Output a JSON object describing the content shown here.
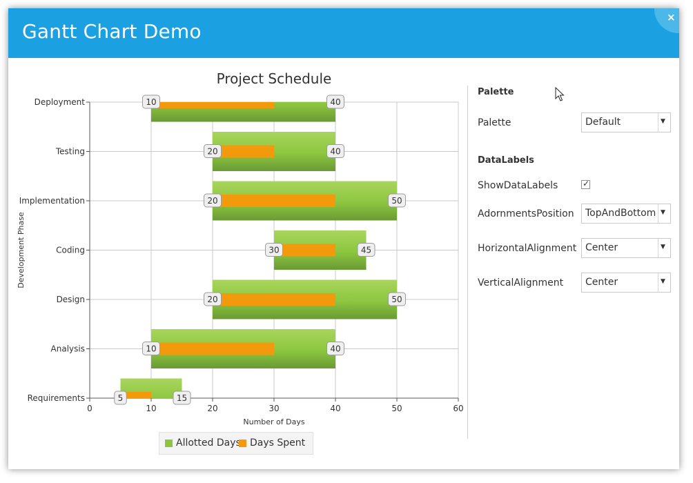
{
  "window": {
    "title": "Gantt Chart Demo",
    "close_glyph": "×"
  },
  "colors": {
    "titlebar": "#1ba1e2",
    "allotted": "#8cc63f",
    "spent": "#f39a0c"
  },
  "chart_data": {
    "type": "bar",
    "orientation": "horizontal-range",
    "title": "Project Schedule",
    "xlabel": "Number of Days",
    "ylabel": "Development Phase",
    "xlim": [
      0,
      60
    ],
    "xticks": [
      0,
      10,
      20,
      30,
      40,
      50,
      60
    ],
    "grid": true,
    "categories": [
      "Requirements",
      "Analysis",
      "Design",
      "Coding",
      "Implementation",
      "Testing",
      "Deployment"
    ],
    "series": [
      {
        "name": "Allotted Days",
        "color": "#8cc63f",
        "ranges": [
          [
            5,
            15
          ],
          [
            10,
            40
          ],
          [
            20,
            50
          ],
          [
            30,
            45
          ],
          [
            20,
            50
          ],
          [
            20,
            40
          ],
          [
            10,
            40
          ]
        ]
      },
      {
        "name": "Days Spent",
        "color": "#f39a0c",
        "ranges": [
          [
            6,
            10
          ],
          [
            10,
            30
          ],
          [
            20,
            40
          ],
          [
            30,
            40
          ],
          [
            20,
            40
          ],
          [
            20,
            30
          ],
          [
            10,
            30
          ]
        ]
      }
    ],
    "data_labels": [
      [
        "5",
        "15"
      ],
      [
        "10",
        "40"
      ],
      [
        "20",
        "50"
      ],
      [
        "30",
        "45"
      ],
      [
        "20",
        "50"
      ],
      [
        "20",
        "40"
      ],
      [
        "10",
        "40"
      ]
    ],
    "legend_position": "bottom"
  },
  "legend": {
    "items": [
      {
        "label": "Allotted Days",
        "color": "#8cc63f"
      },
      {
        "label": "Days Spent",
        "color": "#f39a0c"
      }
    ]
  },
  "panel": {
    "palette_section": "Palette",
    "palette_label": "Palette",
    "palette_value": "Default",
    "datalabels_section": "DataLabels",
    "show_labels_label": "ShowDataLabels",
    "show_labels_checked": true,
    "adornments_label": "AdornmentsPosition",
    "adornments_value": "TopAndBottom",
    "halign_label": "HorizontalAlignment",
    "halign_value": "Center",
    "valign_label": "VerticalAlignment",
    "valign_value": "Center",
    "check_glyph": "✓",
    "arrow_glyph": "▼"
  }
}
